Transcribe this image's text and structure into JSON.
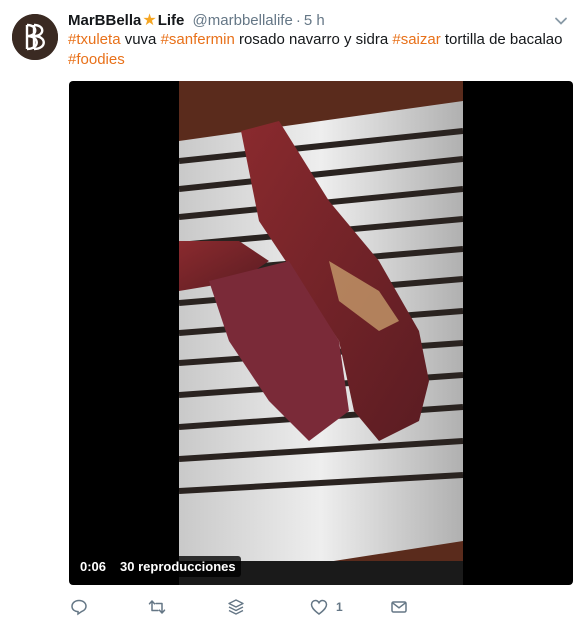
{
  "tweet": {
    "author_name": "MarBBella",
    "author_name_suffix": "Life",
    "handle": "@marbbellalife",
    "separator": "·",
    "time": "5 h",
    "text_parts": [
      {
        "t": "#txuleta",
        "tag": true
      },
      {
        "t": " vuva ",
        "tag": false
      },
      {
        "t": "#sanfermin",
        "tag": true
      },
      {
        "t": " rosado navarro y sidra ",
        "tag": false
      },
      {
        "t": "#saizar",
        "tag": true
      },
      {
        "t": " tortilla de bacalao",
        "tag": false
      },
      {
        "t": "#foodies",
        "tag": true
      }
    ]
  },
  "video": {
    "duration": "0:06",
    "views": "30 reproducciones"
  },
  "actions": {
    "like_count": "1"
  },
  "colors": {
    "hashtag": "#e8711a",
    "muted": "#657786",
    "star": "#f5a623"
  },
  "icons": {
    "avatar": "bb-monogram-logo",
    "caret": "chevron-down-icon",
    "reply": "reply-icon",
    "retweet": "retweet-icon",
    "stack": "stack-icon",
    "like": "heart-icon",
    "dm": "envelope-icon"
  }
}
